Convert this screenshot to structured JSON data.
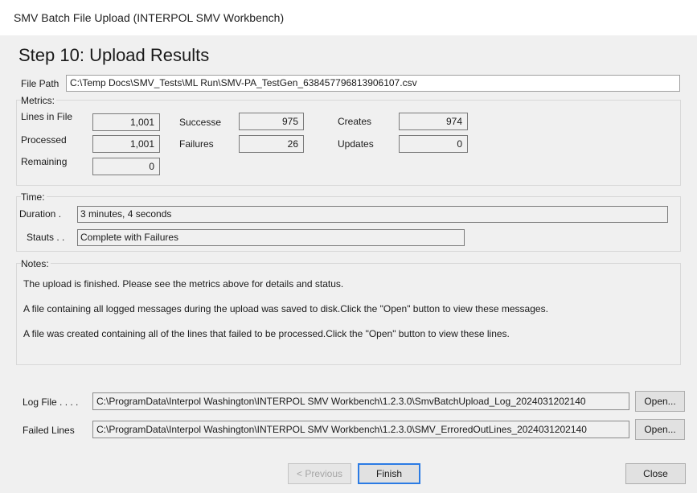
{
  "window": {
    "title": "SMV Batch File Upload (INTERPOL SMV Workbench)"
  },
  "heading": "Step 10: Upload Results",
  "file_path": {
    "label": "File Path",
    "value": "C:\\Temp Docs\\SMV_Tests\\ML Run\\SMV-PA_TestGen_638457796813906107.csv"
  },
  "metrics": {
    "title": "Metrics:",
    "lines_in_file": {
      "label": "Lines in File",
      "value": "1,001"
    },
    "processed": {
      "label": "Processed",
      "value": "1,001"
    },
    "remaining": {
      "label": "Remaining",
      "value": "0"
    },
    "successes": {
      "label": "Successe",
      "value": "975"
    },
    "failures": {
      "label": "Failures",
      "value": "26"
    },
    "creates": {
      "label": "Creates",
      "value": "974"
    },
    "updates": {
      "label": "Updates",
      "value": "0"
    }
  },
  "time": {
    "title": "Time:",
    "duration": {
      "label": "Duration .",
      "value": "3 minutes, 4 seconds"
    },
    "status": {
      "label": "Stauts . .",
      "value": "Complete with Failures"
    }
  },
  "notes": {
    "title": "Notes:",
    "lines": [
      "The upload is finished. Please see the metrics above for details and status.",
      "A file containing all logged messages during the upload was saved to disk.Click the \"Open\" button to view these messages.",
      "A file was created containing all of the lines that failed to be processed.Click the \"Open\" button to view these lines."
    ]
  },
  "log_file": {
    "label": "Log File . . . .",
    "value": "C:\\ProgramData\\Interpol Washington\\INTERPOL SMV Workbench\\1.2.3.0\\SmvBatchUpload_Log_2024031202140",
    "button": "Open..."
  },
  "failed_lines": {
    "label": "Failed Lines",
    "value": "C:\\ProgramData\\Interpol Washington\\INTERPOL SMV Workbench\\1.2.3.0\\SMV_ErroredOutLines_2024031202140",
    "button": "Open..."
  },
  "buttons": {
    "previous": "< Previous",
    "finish": "Finish",
    "close": "Close"
  }
}
